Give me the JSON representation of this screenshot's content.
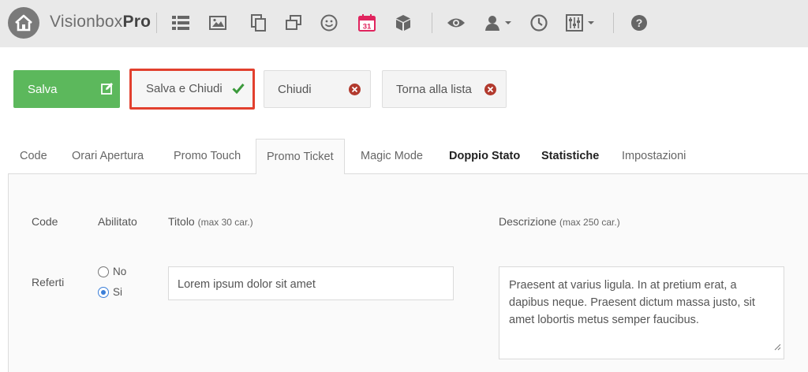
{
  "brand": {
    "name_light": "Visionbox",
    "name_bold": "Pro"
  },
  "toolbar": {
    "icons": [
      "home-icon",
      "list-icon",
      "image-icon",
      "copy-icon",
      "layers-icon",
      "smiley-icon",
      "calendar-icon",
      "cube-icon",
      "eye-icon",
      "user-icon",
      "clock-icon",
      "sliders-icon",
      "help-icon"
    ],
    "calendar_day": "31"
  },
  "actions": {
    "save_label": "Salva",
    "save_close_label": "Salva e Chiudi",
    "close_label": "Chiudi",
    "back_label": "Torna alla lista"
  },
  "tabs": [
    {
      "label": "Code"
    },
    {
      "label": "Orari Apertura"
    },
    {
      "label": "Promo Touch"
    },
    {
      "label": "Promo Ticket",
      "active": true
    },
    {
      "label": "Magic Mode"
    },
    {
      "label": "Doppio Stato",
      "bold": true
    },
    {
      "label": "Statistiche",
      "bold": true
    },
    {
      "label": "Impostazioni"
    }
  ],
  "table": {
    "headers": {
      "code": "Code",
      "enabled": "Abilitato",
      "title": "Titolo",
      "title_hint": "(max 30 car.)",
      "description": "Descrizione",
      "description_hint": "(max 250 car.)"
    },
    "row": {
      "code": "Referti",
      "radio_no": "No",
      "radio_yes": "Si",
      "enabled_selected": "Si",
      "title_value": "Lorem ipsum dolor sit amet",
      "description_value": "Praesent at varius ligula. In at pretium erat, a dapibus neque. Praesent dictum massa justo, sit amet lobortis metus semper faucibus."
    }
  },
  "colors": {
    "topbar": "#e9e9e9",
    "save_green": "#5cb85c",
    "highlight_red": "#e2402e",
    "close_red": "#b23a2e",
    "check_green": "#3c9a3c",
    "calendar_pink": "#e0245e",
    "radio_blue": "#3b7fd8"
  }
}
